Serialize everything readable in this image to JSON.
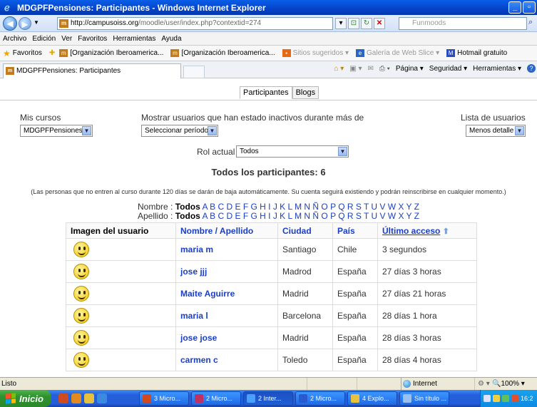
{
  "window": {
    "title": "MDGPFPensiones: Participantes - Windows Internet Explorer",
    "minimize": "_",
    "maximize": "▫"
  },
  "address": {
    "url_host": "http://campusoiss.org",
    "url_path": "/moodle/user/index.php?contextid=274",
    "search_placeholder": "Funmoods"
  },
  "menu": [
    "Archivo",
    "Edición",
    "Ver",
    "Favoritos",
    "Herramientas",
    "Ayuda"
  ],
  "favorites_bar": {
    "favorites_label": "Favoritos",
    "items": [
      "[Organización Iberoamerica...",
      "[Organización Iberoamerica...",
      "Sitios sugeridos ▾",
      "Galería de Web Slice ▾",
      "Hotmail gratuito"
    ]
  },
  "tab": {
    "label": "MDGPFPensiones: Participantes"
  },
  "command_bar": [
    "Página ▾",
    "Seguridad ▾",
    "Herramientas ▾"
  ],
  "page": {
    "tabs": [
      "Participantes",
      "Blogs"
    ],
    "mis_cursos_label": "Mis cursos",
    "mis_cursos_value": "MDGPFPensiones",
    "inactivos_label": "Mostrar usuarios que han estado inactivos durante más de",
    "periodo_value": "Seleccionar período",
    "lista_label": "Lista de usuarios",
    "lista_value": "Menos detalle",
    "rol_label": "Rol actual",
    "rol_value": "Todos",
    "heading": "Todos los participantes: 6",
    "notice": "(Las personas que no entren al curso durante 120 días se darán de baja automáticamente. Su cuenta seguirá existiendo y podrán reinscribirse en cualquier momento.)",
    "nombre_label": "Nombre :",
    "apellido_label": "Apellido :",
    "todos": "Todos",
    "letters": "A B C D E F G H I J K L M N Ñ O P Q R S T U V W X Y Z"
  },
  "table": {
    "headers": {
      "imagen": "Imagen del usuario",
      "nombre_apellido": "Nombre / Apellido",
      "ciudad": "Ciudad",
      "pais": "País",
      "ultimo": "Último acceso"
    },
    "rows": [
      {
        "name": "maria m",
        "ciudad": "Santiago",
        "pais": "Chile",
        "acceso": "3 segundos"
      },
      {
        "name": "jose jjj",
        "ciudad": "Madrod",
        "pais": "España",
        "acceso": "27 días 3 horas"
      },
      {
        "name": "Maite Aguirre",
        "ciudad": "Madrid",
        "pais": "España",
        "acceso": "27 días 21 horas"
      },
      {
        "name": "maria l",
        "ciudad": "Barcelona",
        "pais": "España",
        "acceso": "28 días 1 hora"
      },
      {
        "name": "jose jose",
        "ciudad": "Madrid",
        "pais": "España",
        "acceso": "28 días 3 horas"
      },
      {
        "name": "carmen c",
        "ciudad": "Toledo",
        "pais": "España",
        "acceso": "28 días 4 horas"
      }
    ]
  },
  "status": {
    "text": "Listo",
    "zone": "Internet",
    "zoom": "100%"
  },
  "taskbar": {
    "start": "Inicio",
    "buttons": [
      "3 Micro...",
      "2 Micro...",
      "2 Inter...",
      "2 Micro...",
      "4 Explo...",
      "Sin título ..."
    ],
    "clock": "16:2"
  }
}
